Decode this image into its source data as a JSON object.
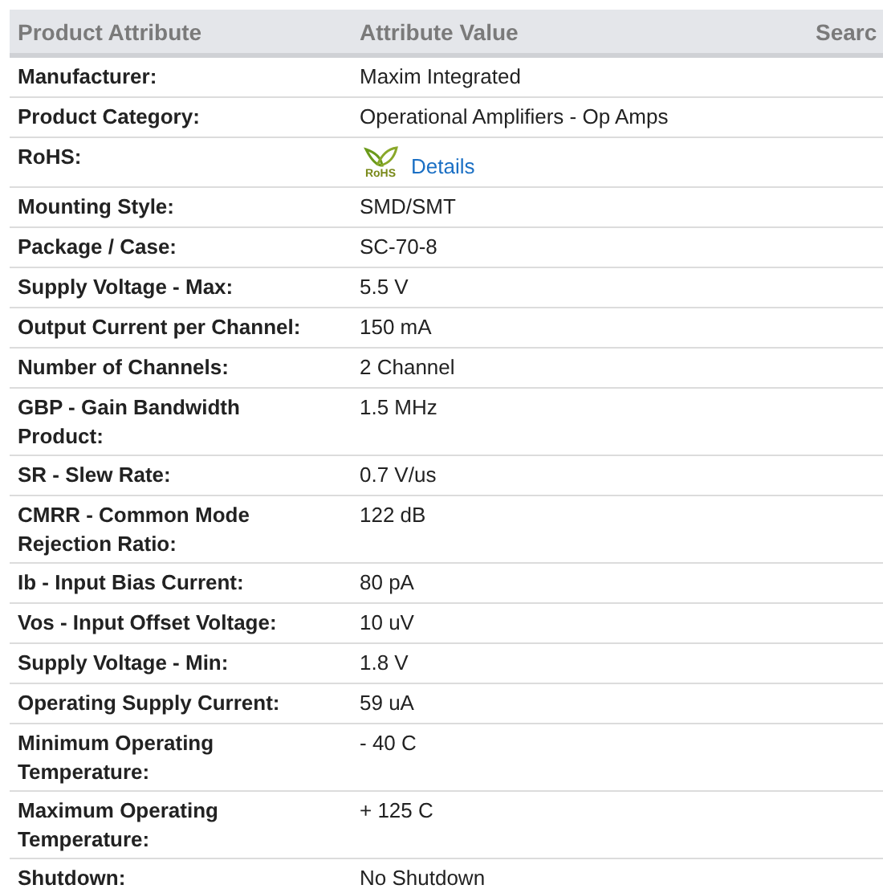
{
  "table": {
    "columns": [
      "Product Attribute",
      "Attribute Value",
      "Searc"
    ],
    "rows": [
      {
        "kind": "text",
        "attribute": "Manufacturer:",
        "value": "Maxim Integrated"
      },
      {
        "kind": "text",
        "attribute": "Product Category:",
        "value": "Operational Amplifiers - Op Amps"
      },
      {
        "kind": "rohs",
        "attribute": "RoHS:",
        "logo_text": "RoHS",
        "value": "Details"
      },
      {
        "kind": "text",
        "attribute": "Mounting Style:",
        "value": "SMD/SMT"
      },
      {
        "kind": "text",
        "attribute": "Package / Case:",
        "value": "SC-70-8"
      },
      {
        "kind": "text",
        "attribute": "Supply Voltage - Max:",
        "value": "5.5 V"
      },
      {
        "kind": "text",
        "attribute": "Output Current per Channel:",
        "value": "150 mA"
      },
      {
        "kind": "text",
        "attribute": "Number of Channels:",
        "value": "2 Channel"
      },
      {
        "kind": "text",
        "attribute": "GBP - Gain Bandwidth Product:",
        "value": "1.5 MHz"
      },
      {
        "kind": "text",
        "attribute": "SR - Slew Rate:",
        "value": "0.7 V/us"
      },
      {
        "kind": "text",
        "attribute": "CMRR - Common Mode Rejection Ratio:",
        "value": "122 dB"
      },
      {
        "kind": "text",
        "attribute": "Ib - Input Bias Current:",
        "value": "80 pA"
      },
      {
        "kind": "text",
        "attribute": "Vos - Input Offset Voltage:",
        "value": "10 uV"
      },
      {
        "kind": "text",
        "attribute": "Supply Voltage - Min:",
        "value": "1.8 V"
      },
      {
        "kind": "text",
        "attribute": "Operating Supply Current:",
        "value": "59 uA"
      },
      {
        "kind": "text",
        "attribute": "Minimum Operating Temperature:",
        "value": "- 40 C"
      },
      {
        "kind": "text",
        "attribute": "Maximum Operating Temperature:",
        "value": "+ 125 C"
      },
      {
        "kind": "text",
        "attribute": "Shutdown:",
        "value": "No Shutdown"
      }
    ]
  }
}
